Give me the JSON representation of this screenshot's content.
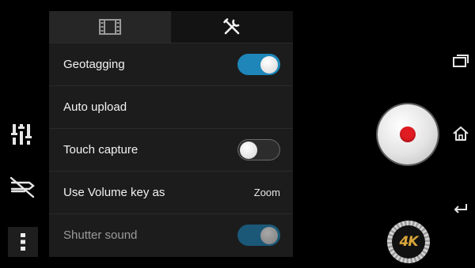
{
  "tabs": [
    {
      "name": "video",
      "icon": "film-strip-icon"
    },
    {
      "name": "settings",
      "icon": "tools-icon"
    }
  ],
  "settings": {
    "rows": [
      {
        "label": "Geotagging",
        "control": "toggle",
        "state": "on"
      },
      {
        "label": "Auto upload",
        "control": "none"
      },
      {
        "label": "Touch capture",
        "control": "toggle",
        "state": "off"
      },
      {
        "label": "Use Volume key as",
        "control": "value",
        "value": "Zoom"
      },
      {
        "label": "Shutter sound",
        "control": "toggle",
        "state": "on",
        "disabled": true
      }
    ]
  },
  "left_controls": [
    "sliders-icon",
    "flash-off-icon",
    "more-vertical-icon"
  ],
  "record": {
    "icon": "record-icon"
  },
  "mode_badge": {
    "label": "4K"
  },
  "nav": [
    "recents-icon",
    "home-icon",
    "back-icon"
  ],
  "colors": {
    "accent": "#1e86b8",
    "record": "#e01b22",
    "badge": "#d9a53a"
  }
}
